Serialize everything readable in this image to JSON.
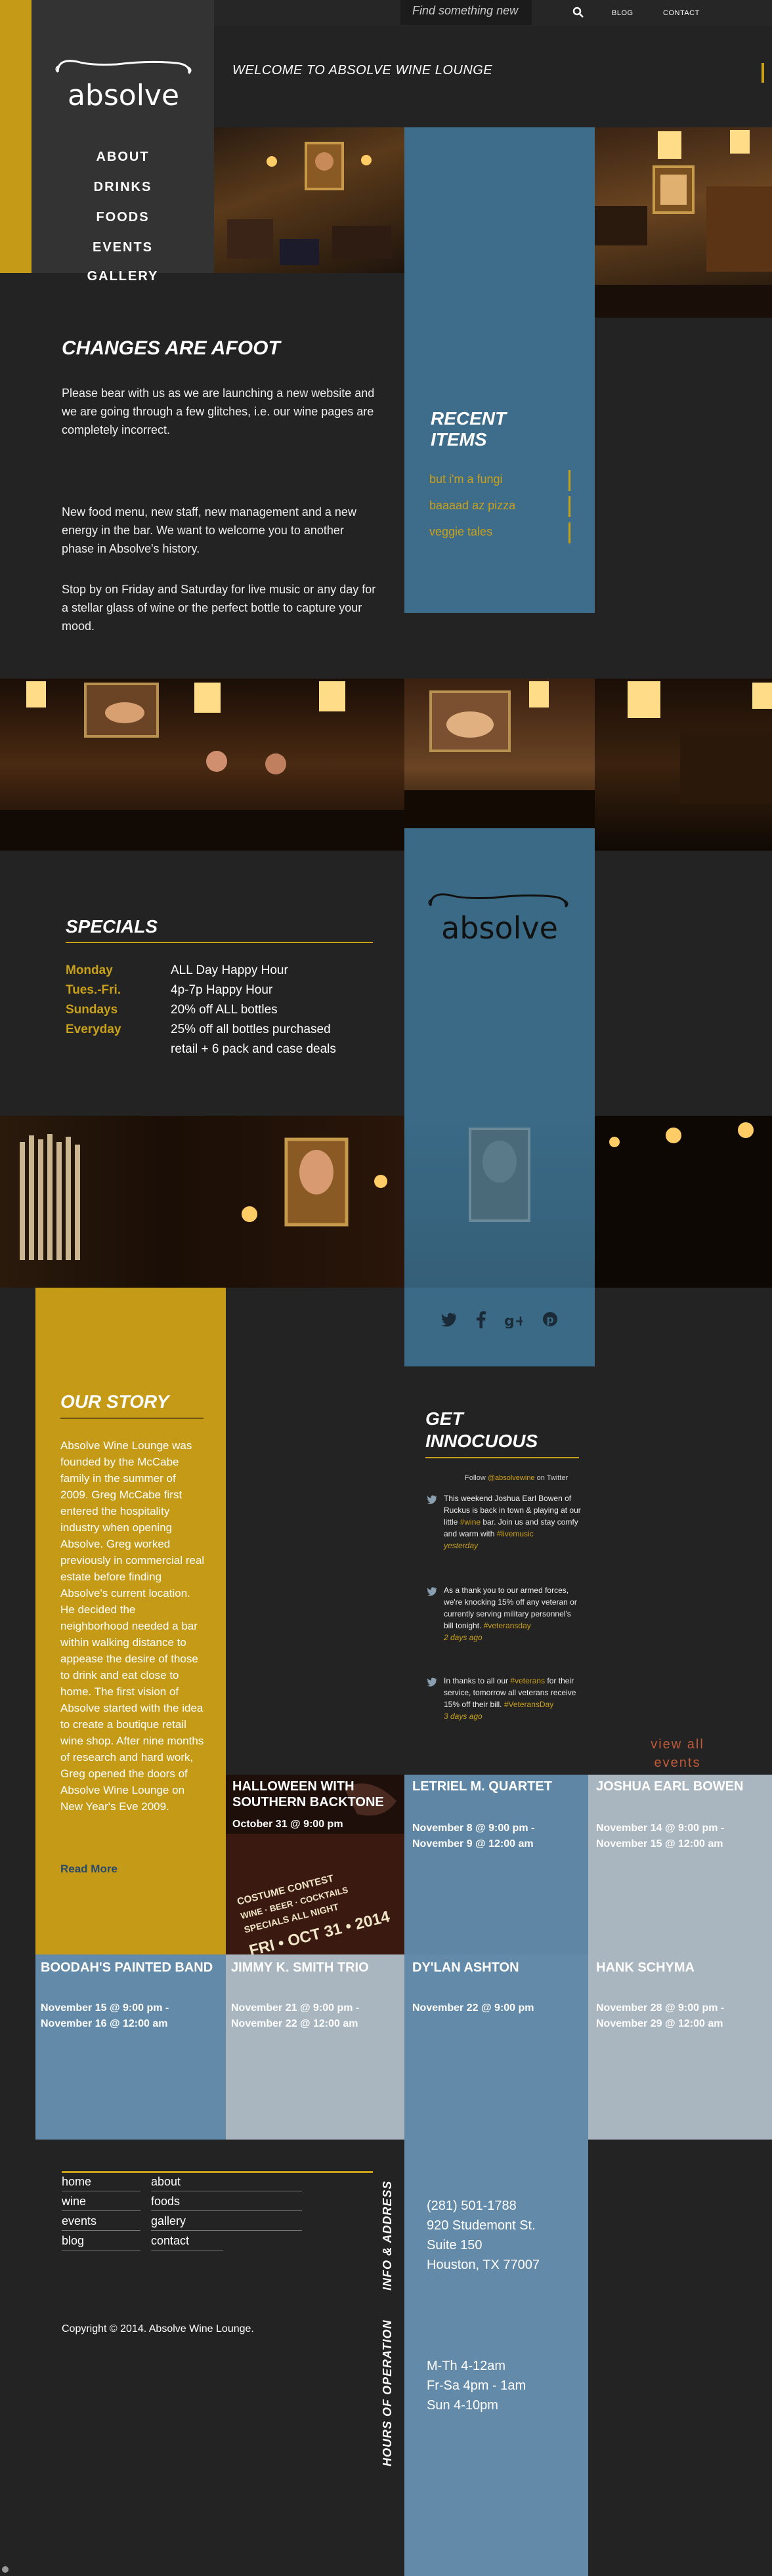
{
  "header": {
    "search_placeholder": "Find something new",
    "links": [
      "BLOG",
      "CONTACT"
    ],
    "welcome": "WELCOME TO ABSOLVE WINE LOUNGE"
  },
  "logo": {
    "text": "absolve"
  },
  "nav": {
    "items": [
      "ABOUT",
      "DRINKS",
      "FOODS",
      "EVENTS",
      "GALLERY"
    ]
  },
  "intro": {
    "heading": "CHANGES ARE AFOOT",
    "paragraphs": [
      "Please bear with us as we are launching a new website and we are going through a few glitches, i.e. our wine pages are completely incorrect.",
      "New food menu, new staff, new management and a new energy in the bar. We want to welcome you to another phase in Absolve's history.",
      "Stop by on Friday and Saturday for live music or any day for a stellar glass of wine or the perfect bottle to capture your mood."
    ]
  },
  "recent": {
    "heading_line1": "RECENT",
    "heading_line2": "ITEMS",
    "items": [
      "but i'm a fungi",
      "baaaad az pizza",
      "veggie tales"
    ]
  },
  "specials": {
    "heading": "SPECIALS",
    "rows": [
      {
        "day": "Monday",
        "desc": "ALL Day Happy Hour"
      },
      {
        "day": "Tues.-Fri.",
        "desc": "4p-7p Happy Hour"
      },
      {
        "day": "Sundays",
        "desc": "20% off ALL bottles"
      },
      {
        "day": "Everyday",
        "desc": "25% off all bottles purchased"
      }
    ],
    "extra": "retail + 6 pack and case deals"
  },
  "social": {
    "icons": [
      "twitter-icon",
      "facebook-icon",
      "google-plus-icon",
      "pinterest-icon"
    ]
  },
  "story": {
    "heading": "OUR STORY",
    "text": "Absolve Wine Lounge was founded by the McCabe family in the summer of 2009. Greg McCabe first entered the hospitality industry when opening Absolve. Greg worked previously in commercial real estate before finding Absolve's current location. He decided the neighborhood needed a bar within walking distance to appease the desire of those to drink and eat close to home. The first vision of Absolve started with the idea to create a boutique retail wine shop. After nine months of research and hard work, Greg opened the doors of Absolve Wine Lounge on New Year's Eve 2009.",
    "read_more": "Read More"
  },
  "twitter": {
    "heading_line1": "GET",
    "heading_line2": "INNOCUOUS",
    "follow_prefix": "Follow ",
    "follow_handle": "@absolvewine",
    "follow_suffix": " on Twitter",
    "tweets": [
      {
        "text": "This weekend Joshua Earl Bowen of Ruckus is back in town & playing at our little ",
        "tag": "#wine",
        "text2": " bar. Join us and stay comfy and warm with ",
        "tag2": "#livemusic",
        "time": "yesterday"
      },
      {
        "text": "As a thank you to our armed forces, we're knocking 15% off any veteran or currently serving military personnel's bill tonight. ",
        "tag": "#veteransday",
        "text2": "",
        "tag2": "",
        "time": "2 days ago"
      },
      {
        "text": "In thanks to all our ",
        "tag": "#veterans",
        "text2": " for their service, tomorrow all veterans receive 15% off their bill. ",
        "tag2": "#VeteransDay",
        "time": "3 days ago"
      }
    ],
    "view_all_line1": "view all",
    "view_all_line2": "events"
  },
  "events": [
    {
      "title": "HALLOWEEN WITH SOUTHERN BACKTONE",
      "date1": "October 31 @ 9:00 pm",
      "date2": "",
      "color": "#2a1410"
    },
    {
      "title": "LETRIEL M. QUARTET",
      "date1": "November 8 @ 9:00 pm -",
      "date2": "November 9 @ 12:00 am",
      "color": "#5f87a5"
    },
    {
      "title": "JOSHUA EARL BOWEN",
      "date1": "November 14 @ 9:00 pm -",
      "date2": "November 15 @ 12:00 am",
      "color": "#a9b6bf"
    },
    {
      "title": "BOODAH'S PAINTED BAND",
      "date1": "November 15 @ 9:00 pm -",
      "date2": "November 16 @ 12:00 am",
      "color": "#638aa8"
    },
    {
      "title": "JIMMY K. SMITH TRIO",
      "date1": "November 21 @ 9:00 pm -",
      "date2": "November 22 @ 12:00 am",
      "color": "#a9b6bf"
    },
    {
      "title": "DY'LAN ASHTON",
      "date1": "November 22 @ 9:00 pm",
      "date2": "",
      "color": "#638aa8"
    },
    {
      "title": "HANK SCHYMA",
      "date1": "November 28 @ 9:00 pm -",
      "date2": "November 29 @ 12:00 am",
      "color": "#a9b6bf"
    }
  ],
  "halloween_poster": {
    "line1": "COSTUME CONTEST",
    "line2": "WINE · BEER · COCKTAILS",
    "line3": "SPECIALS ALL NIGHT",
    "line4": "FRI • OCT 31 • 2014"
  },
  "footer": {
    "links_col1": [
      "home",
      "wine",
      "events",
      "blog"
    ],
    "links_col2": [
      "about",
      "foods",
      "gallery",
      "contact"
    ],
    "copyright": "Copyright © 2014. Absolve Wine Lounge.",
    "info_label": "INFO & ADDRESS",
    "hours_label": "HOURS OF OPERATION",
    "address": [
      "(281) 501-1788",
      "920 Studemont St.",
      "Suite 150",
      "Houston, TX 77007"
    ],
    "hours": [
      "M-Th 4-12am",
      "Fr-Sa 4pm - 1am",
      "Sun 4-10pm"
    ]
  }
}
